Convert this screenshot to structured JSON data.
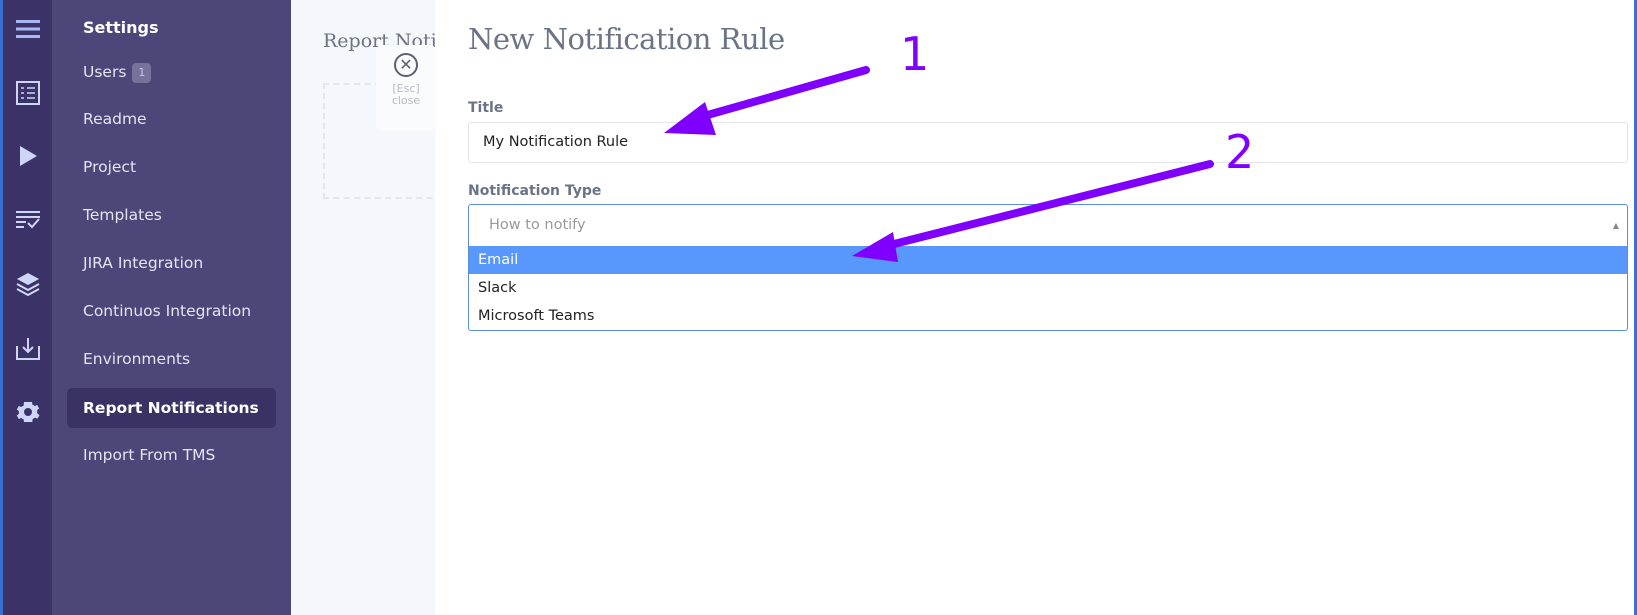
{
  "sidebar": {
    "heading": "Settings",
    "items": [
      {
        "label": "Users",
        "badge": "1"
      },
      {
        "label": "Readme"
      },
      {
        "label": "Project"
      },
      {
        "label": "Templates"
      },
      {
        "label": "JIRA Integration"
      },
      {
        "label": "Continuos Integration"
      },
      {
        "label": "Environments"
      },
      {
        "label": "Report Notifications",
        "active": true
      },
      {
        "label": "Import From TMS"
      }
    ]
  },
  "iconbar": [
    "menu-icon",
    "checklist-icon",
    "play-icon",
    "test-runs-icon",
    "layers-icon",
    "import-icon",
    "gear-icon"
  ],
  "background": {
    "title": "Report Noti",
    "close_key": "[Esc]",
    "close_label": "close"
  },
  "panel": {
    "title": "New Notification Rule",
    "title_label": "Title",
    "title_value": "My Notification Rule",
    "type_label": "Notification Type",
    "type_placeholder": "How to notify",
    "options": [
      "Email",
      "Slack",
      "Microsoft Teams"
    ],
    "highlighted_option": "Email"
  },
  "annotations": {
    "one": "1",
    "two": "2",
    "color": "#8000ff"
  },
  "colors": {
    "accent": "#5897fb",
    "sidebar": "#4d4779",
    "iconbar": "#3b3368"
  }
}
